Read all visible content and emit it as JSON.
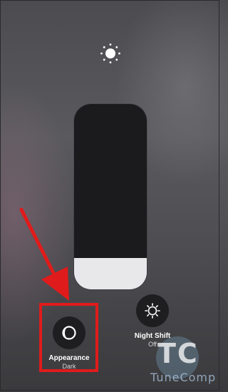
{
  "brightness": {
    "icon": "sun-icon",
    "level": 0.17
  },
  "controls": [
    {
      "title": "Appearance",
      "value": "Dark",
      "icon": "appearance-icon"
    },
    {
      "title": "Night Shift",
      "value": "Off",
      "icon": "night-shift-icon"
    }
  ],
  "annotation": {
    "color": "#e01b1b"
  },
  "watermark": {
    "letters": "TC",
    "text": "TuneComp"
  }
}
